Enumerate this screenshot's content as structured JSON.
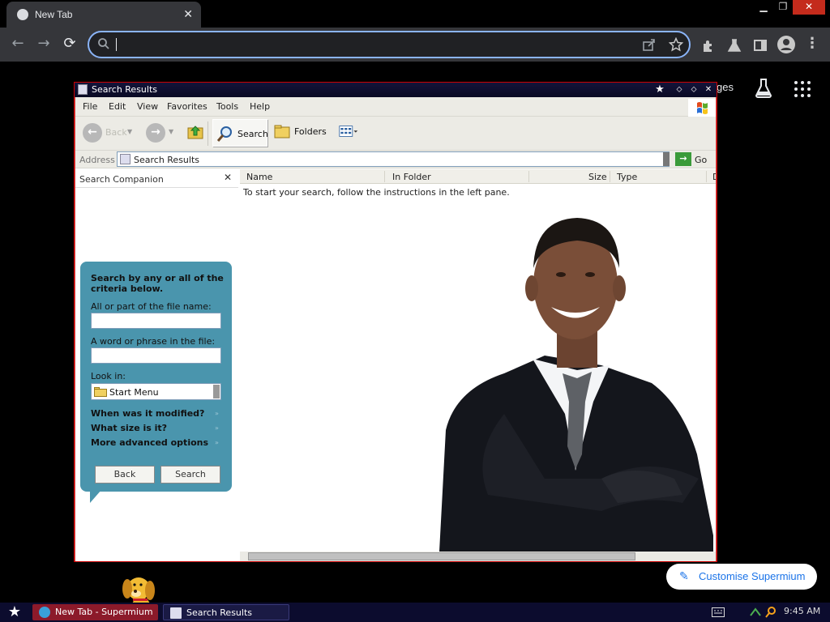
{
  "browser": {
    "tab_title": "New Tab",
    "tab_close": "✕",
    "window_controls": {
      "minimize": "▁",
      "maximize": "❐",
      "close": "✕"
    },
    "nav": {
      "back": "←",
      "forward": "→",
      "reload": "⟳"
    },
    "omnibox_value": "",
    "toolbar_icons": [
      "extensions-icon",
      "labs-icon",
      "side-panel-icon",
      "profile-icon",
      "menu-icon"
    ],
    "menu": "⋮"
  },
  "ntp": {
    "partial_link": "ges",
    "customise_label": "Customise Supermium",
    "customise_icon": "✎"
  },
  "xp_window": {
    "title": "Search Results",
    "title_buttons": [
      "★",
      "⬦",
      "⬦",
      "✕"
    ],
    "menus": [
      "File",
      "Edit",
      "View",
      "Favorites",
      "Tools",
      "Help"
    ],
    "toolbar": {
      "back": "Back",
      "back_arrow": "←",
      "forward_arrow": "→",
      "search": "Search",
      "folders": "Folders"
    },
    "address": {
      "label": "Address",
      "value": "Search Results",
      "go": "Go",
      "go_arrow": "→"
    },
    "companion": {
      "title": "Search Companion",
      "close": "✕",
      "criteria": "Search by any or all of the criteria below.",
      "name_label": "All or part of the file name:",
      "name_value": "",
      "phrase_label": "A word or phrase in the file:",
      "phrase_value": "",
      "lookin_label": "Look in:",
      "lookin_value": "Start Menu",
      "options": [
        "When was it modified?",
        "What size is it?",
        "More advanced options"
      ],
      "chevron": "»",
      "back_btn": "Back",
      "search_btn": "Search"
    },
    "columns": [
      "Name",
      "In Folder",
      "Size",
      "Type",
      "D"
    ],
    "empty_message": "To start your search, follow the instructions in the left pane."
  },
  "taskbar": {
    "start": "★",
    "items": [
      "New Tab - Supermium",
      "Search Results"
    ],
    "clock": "9:45 AM"
  }
}
